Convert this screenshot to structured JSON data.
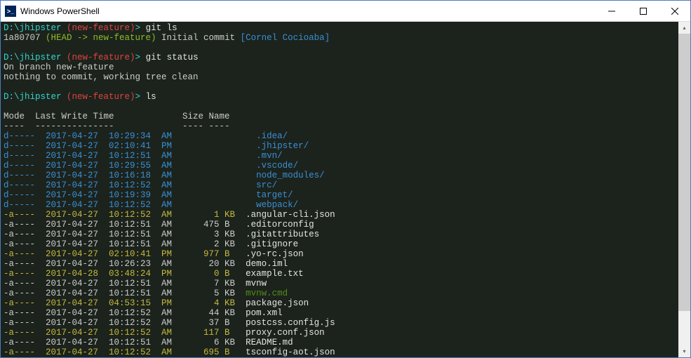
{
  "title": "Windows PowerShell",
  "prompt": {
    "path": "D:\\jhipster",
    "branch": "(new-feature)",
    "sep": ">"
  },
  "cmd1": "git ls",
  "log": {
    "hash": "1a80707",
    "head": "(HEAD -> new-feature)",
    "msg": "Initial commit",
    "author": "[Cornel Cocioaba]"
  },
  "cmd2": "git status",
  "status1": "On branch new-feature",
  "status2": "nothing to commit, working tree clean",
  "cmd3": "ls",
  "hdr": "Mode  Last Write Time             Size Name",
  "hdrU": "----  ---------------             ---- ----",
  "rows": [
    {
      "l": "d-----  2017-04-27  10:29:34  AM                ",
      "n": ".idea/",
      "d": true,
      "hl": false
    },
    {
      "l": "d-----  2017-04-27  02:10:41  PM                ",
      "n": ".jhipster/",
      "d": true,
      "hl": false
    },
    {
      "l": "d-----  2017-04-27  10:12:51  AM                ",
      "n": ".mvn/",
      "d": true,
      "hl": false
    },
    {
      "l": "d-----  2017-04-27  10:29:55  AM                ",
      "n": ".vscode/",
      "d": true,
      "hl": false
    },
    {
      "l": "d-----  2017-04-27  10:16:18  AM                ",
      "n": "node_modules/",
      "d": true,
      "hl": false
    },
    {
      "l": "d-----  2017-04-27  10:12:52  AM                ",
      "n": "src/",
      "d": true,
      "hl": false
    },
    {
      "l": "d-----  2017-04-27  10:19:39  AM                ",
      "n": "target/",
      "d": true,
      "hl": false
    },
    {
      "l": "d-----  2017-04-27  10:12:52  AM                ",
      "n": "webpack/",
      "d": true,
      "hl": false
    },
    {
      "l": "-a----  2017-04-27  10:12:52  AM        1 KB  ",
      "n": ".angular-cli.json",
      "d": false,
      "hl": true
    },
    {
      "l": "-a----  2017-04-27  10:12:51  AM      475 B   ",
      "n": ".editorconfig",
      "d": false,
      "hl": false
    },
    {
      "l": "-a----  2017-04-27  10:12:51  AM        3 KB  ",
      "n": ".gitattributes",
      "d": false,
      "hl": false
    },
    {
      "l": "-a----  2017-04-27  10:12:51  AM        2 KB  ",
      "n": ".gitignore",
      "d": false,
      "hl": false
    },
    {
      "l": "-a----  2017-04-27  02:10:41  PM      977 B   ",
      "n": ".yo-rc.json",
      "d": false,
      "hl": true
    },
    {
      "l": "-a----  2017-04-27  10:26:23  AM       20 KB  ",
      "n": "demo.iml",
      "d": false,
      "hl": false
    },
    {
      "l": "-a----  2017-04-28  03:48:24  PM        0 B   ",
      "n": "example.txt",
      "d": false,
      "hl": true
    },
    {
      "l": "-a----  2017-04-27  10:12:51  AM        7 KB  ",
      "n": "mvnw",
      "d": false,
      "hl": false
    },
    {
      "l": "-a----  2017-04-27  10:12:51  AM        5 KB  ",
      "n": "mvnw.cmd",
      "d": false,
      "hl": false,
      "exec": true
    },
    {
      "l": "-a----  2017-04-27  04:53:15  PM        4 KB  ",
      "n": "package.json",
      "d": false,
      "hl": true
    },
    {
      "l": "-a----  2017-04-27  10:12:52  AM       44 KB  ",
      "n": "pom.xml",
      "d": false,
      "hl": false
    },
    {
      "l": "-a----  2017-04-27  10:12:52  AM       37 B   ",
      "n": "postcss.config.js",
      "d": false,
      "hl": false
    },
    {
      "l": "-a----  2017-04-27  10:12:52  AM      117 B   ",
      "n": "proxy.conf.json",
      "d": false,
      "hl": true
    },
    {
      "l": "-a----  2017-04-27  10:12:51  AM        6 KB  ",
      "n": "README.md",
      "d": false,
      "hl": false
    },
    {
      "l": "-a----  2017-04-27  10:12:52  AM      695 B   ",
      "n": "tsconfig-aot.json",
      "d": false,
      "hl": true
    }
  ]
}
